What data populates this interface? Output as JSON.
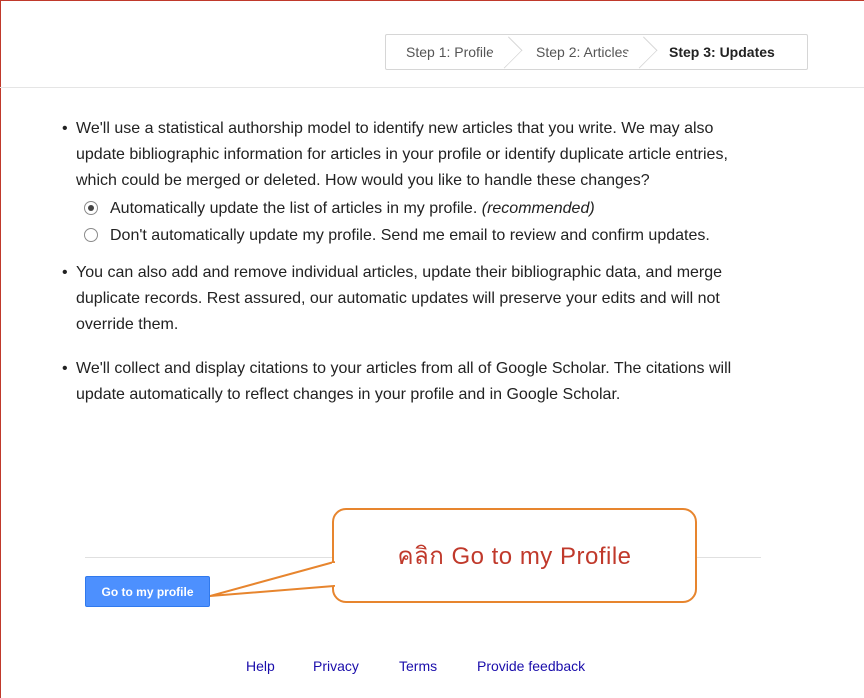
{
  "steps": {
    "step1": "Step 1: Profile",
    "step2": "Step 2: Articles",
    "step3": "Step 3: Updates"
  },
  "content": {
    "bullet": "•",
    "intro": "We'll use a statistical authorship model to identify new articles that you write. We may also update bibliographic information for articles in your profile or identify duplicate article entries, which could be merged or deleted. How would you like to handle these changes?",
    "options": [
      {
        "label": "Automatically update the list of articles in my profile.",
        "note": "(recommended)",
        "selected": true
      },
      {
        "label": "Don't automatically update my profile. Send me email to review and confirm updates.",
        "note": "",
        "selected": false
      }
    ],
    "para2": "You can also add and remove individual articles, update their bibliographic data, and merge duplicate records. Rest assured, our automatic updates will preserve your edits and will not override them.",
    "para3": "We'll collect and display citations to your articles from all of Google Scholar. The citations will update automatically to reflect changes in your profile and in Google Scholar."
  },
  "button": {
    "go_to_profile": "Go to my profile"
  },
  "footer": {
    "help": "Help",
    "privacy": "Privacy",
    "terms": "Terms",
    "feedback": "Provide feedback"
  },
  "annotation": {
    "callout_text": "คลิก Go to my Profile",
    "color": "#e7852e"
  },
  "colors": {
    "button_blue": "#4d90fe",
    "link_blue": "#1a0dab"
  }
}
